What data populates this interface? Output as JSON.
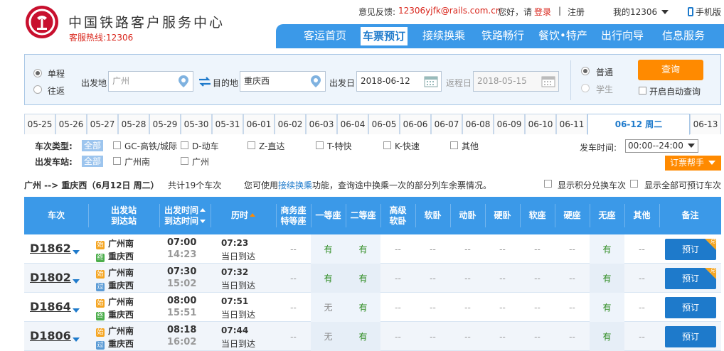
{
  "header": {
    "title": "中国铁路客户服务中心",
    "hotline": "客服热线:12306",
    "feedback_label": "意见反馈:",
    "feedback_email": "12306yjfk@rails.com.cn",
    "greeting": "您好，请",
    "login": "登录",
    "divider": "|",
    "register": "注册",
    "my12306": "我的12306",
    "mobile": "手机版"
  },
  "nav": {
    "items": [
      "客运首页",
      "车票预订",
      "接续换乘",
      "铁路畅行",
      "餐饮•特产",
      "出行向导",
      "信息服务"
    ],
    "active_index": 1
  },
  "query": {
    "trip_one_way": "单程",
    "trip_round": "往返",
    "from_label": "出发地",
    "from_value": "广州",
    "to_label": "目的地",
    "to_value": "重庆西",
    "depart_label": "出发日",
    "depart_value": "2018-06-12",
    "return_label": "返程日",
    "return_value": "2018-05-15",
    "ticket_normal": "普通",
    "ticket_student": "学生",
    "search_button": "查询",
    "auto_query": "开启自动查询"
  },
  "dates": {
    "tabs": [
      "05-25",
      "05-26",
      "05-27",
      "05-28",
      "05-29",
      "05-30",
      "05-31",
      "06-01",
      "06-02",
      "06-03",
      "06-04",
      "06-05",
      "06-06",
      "06-07",
      "06-08",
      "06-09",
      "06-10",
      "06-11",
      "06-12 周二",
      "06-13"
    ],
    "active_index": 18
  },
  "filters": {
    "type_label": "车次类型:",
    "station_label": "出发车站:",
    "all": "全部",
    "types": [
      "GC-高铁/城际",
      "D-动车",
      "Z-直达",
      "T-特快",
      "K-快速",
      "其他"
    ],
    "stations": [
      "广州南",
      "广州"
    ],
    "time_label": "发车时间:",
    "time_value": "00:00--24:00",
    "help_button": "订票帮手"
  },
  "summary": {
    "route": "广州 --> 重庆西（6月12日  周二）",
    "count_text": "共计19个车次",
    "hint_pre": "您可使用",
    "hint_link": "接续换乘",
    "hint_post": "功能，查询途中换乘一次的部分列车余票情况。",
    "option_points": "显示积分兑换车次",
    "option_all": "显示全部可预订车次"
  },
  "table": {
    "headers": {
      "train": "车次",
      "stations_1": "出发站",
      "stations_2": "到达站",
      "times_1": "出发时间",
      "times_2": "到达时间",
      "duration": "历时",
      "business_1": "商务座",
      "business_2": "特等座",
      "first": "一等座",
      "second": "二等座",
      "adv_1": "高级",
      "adv_2": "软卧",
      "soft_sleeper": "软卧",
      "motion_sleeper": "动卧",
      "hard_sleeper": "硬卧",
      "soft_seat": "软座",
      "hard_seat": "硬座",
      "no_seat": "无座",
      "other": "其他",
      "remark": "备注"
    },
    "tags": {
      "start": "始",
      "end": "终",
      "pass": "过"
    },
    "book_label": "预订",
    "points_badge": "兑",
    "rows": [
      {
        "train": "D1862",
        "from": "广州南",
        "to": "重庆西",
        "from_tag": "始",
        "to_tag": "终",
        "dep": "07:00",
        "arr": "14:23",
        "dur": "07:23",
        "day": "当日到达",
        "seats": [
          "--",
          "有",
          "有",
          "--",
          "--",
          "--",
          "--",
          "--",
          "--",
          "有",
          "--"
        ],
        "points": true
      },
      {
        "train": "D1802",
        "from": "广州南",
        "to": "重庆西",
        "from_tag": "始",
        "to_tag": "过",
        "dep": "07:30",
        "arr": "15:02",
        "dur": "07:32",
        "day": "当日到达",
        "seats": [
          "--",
          "有",
          "有",
          "--",
          "--",
          "--",
          "--",
          "--",
          "--",
          "有",
          "--"
        ],
        "points": true
      },
      {
        "train": "D1864",
        "from": "广州南",
        "to": "重庆西",
        "from_tag": "始",
        "to_tag": "终",
        "dep": "08:00",
        "arr": "15:51",
        "dur": "07:51",
        "day": "当日到达",
        "seats": [
          "--",
          "无",
          "有",
          "--",
          "--",
          "--",
          "--",
          "--",
          "--",
          "有",
          "--"
        ],
        "points": false
      },
      {
        "train": "D1806",
        "from": "广州南",
        "to": "重庆西",
        "from_tag": "始",
        "to_tag": "过",
        "dep": "08:18",
        "arr": "16:02",
        "dur": "07:44",
        "day": "当日到达",
        "seats": [
          "--",
          "无",
          "有",
          "--",
          "--",
          "--",
          "--",
          "--",
          "--",
          "有",
          "--"
        ],
        "points": false
      }
    ]
  }
}
